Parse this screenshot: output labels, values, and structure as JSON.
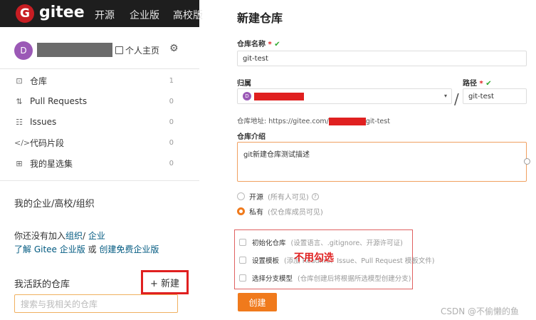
{
  "topbar": {
    "logo_letter": "G",
    "brand": "gitee",
    "nav": [
      "开源",
      "企业版",
      "高校版"
    ]
  },
  "profile": {
    "avatar_letter": "D",
    "homepage_label": "个人主页"
  },
  "menu": [
    {
      "icon": "repo-icon",
      "glyph": "⊡",
      "label": "仓库",
      "count": "1"
    },
    {
      "icon": "pull-request-icon",
      "glyph": "⇅",
      "label": "Pull Requests",
      "count": "0"
    },
    {
      "icon": "issues-icon",
      "glyph": "☷",
      "label": "Issues",
      "count": "0"
    },
    {
      "icon": "code-snippet-icon",
      "glyph": "</>",
      "label": "代码片段",
      "count": "0"
    },
    {
      "icon": "star-collection-icon",
      "glyph": "⊞",
      "label": "我的星选集",
      "count": "0"
    }
  ],
  "org_section": {
    "title": "我的企业/高校/组织",
    "line1_pre": "你还没有加入",
    "line1_link1": "组织",
    "line1_sep": "/ ",
    "line1_link2": "企业",
    "line2_link1": "了解 Gitee 企业版",
    "line2_mid": " 或 ",
    "line2_link2": "创建免费企业版"
  },
  "active_repos": {
    "title": "我活跃的仓库",
    "new_button": "+ 新建",
    "search_placeholder": "搜索与我相关的仓库"
  },
  "form": {
    "title": "新建仓库",
    "repo_name_label": "仓库名称",
    "required_mark": "*",
    "check": "✔",
    "repo_name_value": "git-test",
    "owner_label": "归属",
    "owner_avatar": "D",
    "path_label": "路径",
    "path_value": "git-test",
    "slash": "/",
    "address_prefix": "仓库地址: https://gitee.com/",
    "address_suffix": "git-test",
    "desc_label": "仓库介绍",
    "desc_value": "git新建仓库测试描述",
    "visibility": [
      {
        "label": "开源",
        "hint": "(所有人可见)",
        "checked": false,
        "help": "?"
      },
      {
        "label": "私有",
        "hint": "(仅仓库成员可见)",
        "checked": true
      }
    ],
    "options": [
      {
        "label": "初始化仓库",
        "hint": "(设置语言、.gitignore、开源许可证)"
      },
      {
        "label": "设置模板",
        "hint": "(添加 Readme、Issue、Pull Request 模板文件)"
      },
      {
        "label": "选择分支模型",
        "hint": "(仓库创建后将根据所选模型创建分支)"
      }
    ],
    "annotation": "不用勾选",
    "create_button": "创建"
  },
  "watermark": "CSDN @不偷懒的鱼",
  "colors": {
    "accent": "#f07a1c",
    "highlight_red": "#e02020",
    "topbar_bg": "#1e1e1e",
    "link": "#005980"
  }
}
